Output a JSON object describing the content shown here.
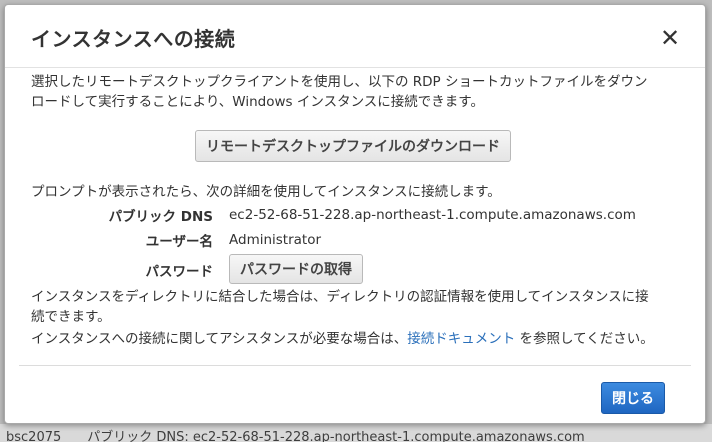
{
  "backdrop": {
    "text": "bsc2075　　パブリック DNS: ec2-52-68-51-228.ap-northeast-1.compute.amazonaws.com"
  },
  "dialog": {
    "title": "インスタンスへの接続",
    "close_glyph": "✕",
    "intro_line1": "選択したリモートデスクトップクライアントを使用し、以下の RDP ショートカットファイルをダウン",
    "intro_line2": "ロードして実行することにより、Windows インスタンスに接続できます。",
    "download_button": "リモートデスクトップファイルのダウンロード",
    "prompt": "プロンプトが表示されたら、次の詳細を使用してインスタンスに接続します。",
    "public_dns_label": "パブリック DNS",
    "public_dns_value": "ec2-52-68-51-228.ap-northeast-1.compute.amazonaws.com",
    "username_label": "ユーザー名",
    "username_value": "Administrator",
    "password_label": "パスワード",
    "password_button": "パスワードの取得",
    "directory_note_line1": "インスタンスをディレクトリに結合した場合は、ディレクトリの認証情報を使用してインスタンスに接",
    "directory_note_line2": "続できます。",
    "help_prefix": "インスタンスへの接続に関してアシスタンスが必要な場合は、",
    "help_link": "接続ドキュメント",
    "help_suffix": " を参照してください。",
    "close_button": "閉じる"
  },
  "colors": {
    "primary_button": "#1f66c1",
    "link": "#2a6fba"
  }
}
